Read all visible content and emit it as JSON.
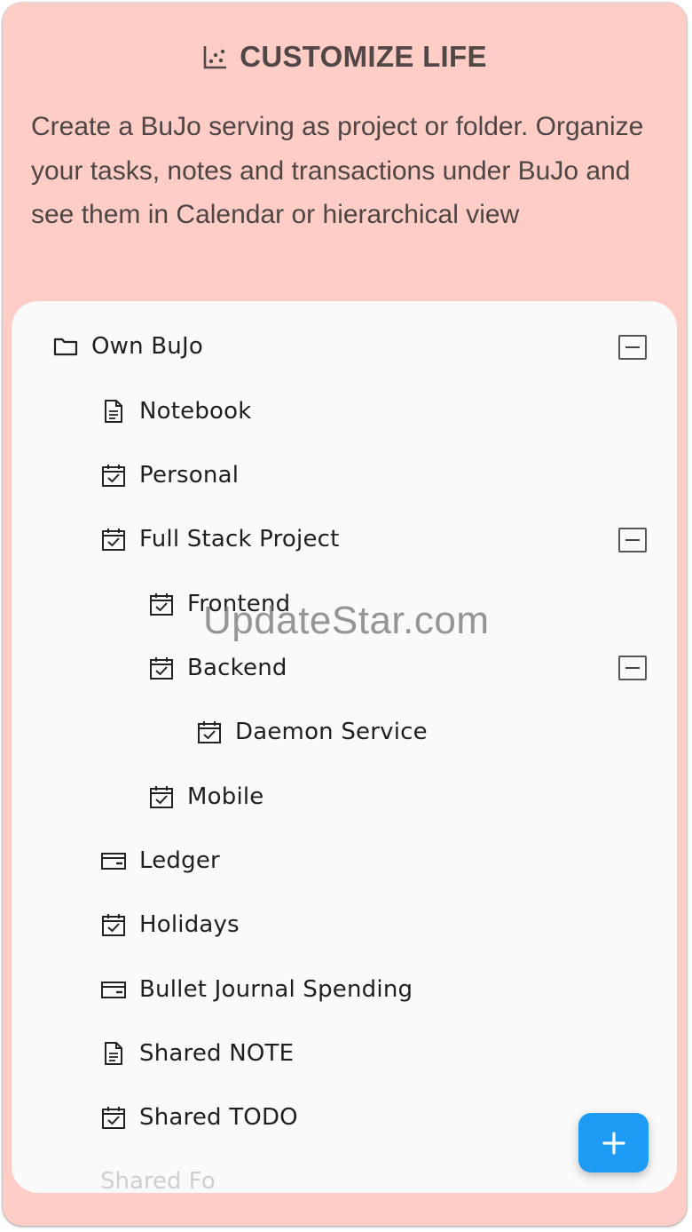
{
  "header": {
    "icon": "chart-dots-icon",
    "title": "CUSTOMIZE LIFE"
  },
  "description": "Create a BuJo serving as project or folder. Organize your tasks, notes and transactions under BuJo and see them in Calendar or hierarchical view",
  "tree": {
    "items": [
      {
        "label": "Own BuJo",
        "icon": "folder-icon",
        "level": 0,
        "expanded": true
      },
      {
        "label": "Notebook",
        "icon": "note-icon",
        "level": 1
      },
      {
        "label": "Personal",
        "icon": "calendar-check-icon",
        "level": 1
      },
      {
        "label": "Full Stack Project",
        "icon": "calendar-check-icon",
        "level": 1,
        "expanded": true
      },
      {
        "label": "Frontend",
        "icon": "calendar-check-icon",
        "level": 2
      },
      {
        "label": "Backend",
        "icon": "calendar-check-icon",
        "level": 2,
        "expanded": true
      },
      {
        "label": "Daemon Service",
        "icon": "calendar-check-icon",
        "level": 3
      },
      {
        "label": "Mobile",
        "icon": "calendar-check-icon",
        "level": 2
      },
      {
        "label": "Ledger",
        "icon": "wallet-icon",
        "level": 1
      },
      {
        "label": "Holidays",
        "icon": "calendar-check-icon",
        "level": 1
      },
      {
        "label": "Bullet Journal Spending",
        "icon": "wallet-icon",
        "level": 1
      },
      {
        "label": "Shared NOTE",
        "icon": "note-icon",
        "level": 1
      },
      {
        "label": "Shared TODO",
        "icon": "calendar-check-icon",
        "level": 1
      }
    ],
    "partial_label": "Shared Fo"
  },
  "fab": {
    "icon": "plus-icon"
  },
  "watermark": "UpdateStar.com",
  "colors": {
    "background": "#fecdc6",
    "panel": "#fafafa",
    "accent": "#1e9bf5",
    "title": "#524747"
  }
}
